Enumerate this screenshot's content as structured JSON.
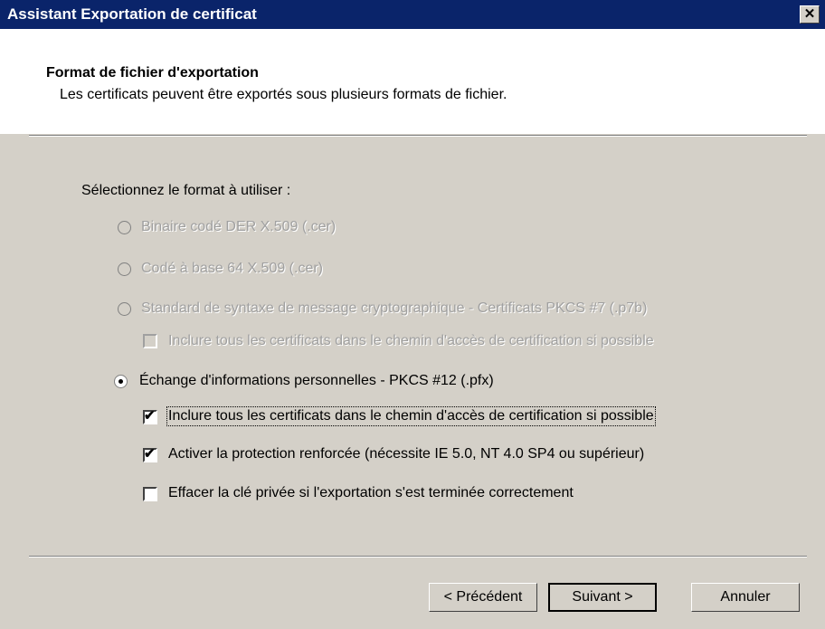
{
  "window": {
    "title": "Assistant Exportation de certificat",
    "close_glyph": "✕"
  },
  "header": {
    "title": "Format de fichier d'exportation",
    "subtitle": "Les certificats peuvent être exportés sous plusieurs formats de fichier."
  },
  "prompt": "Sélectionnez le format à utiliser :",
  "options": [
    {
      "label": "Binaire codé DER X.509 (.cer)",
      "enabled": false,
      "selected": false
    },
    {
      "label": "Codé à base 64 X.509 (.cer)",
      "enabled": false,
      "selected": false
    },
    {
      "label": "Standard de syntaxe de message cryptographique - Certificats PKCS #7 (.p7b)",
      "enabled": false,
      "selected": false
    },
    {
      "label": "Échange d'informations personnelles - PKCS #12 (.pfx)",
      "enabled": true,
      "selected": true
    }
  ],
  "checkboxes": [
    {
      "label": "Inclure tous les certificats dans le chemin d'accès de certification si possible",
      "enabled": false,
      "checked": false
    },
    {
      "label": "Inclure tous les certificats dans le chemin d'accès de certification si possible",
      "enabled": true,
      "checked": true
    },
    {
      "label": "Activer la protection renforcée (nécessite IE 5.0, NT 4.0 SP4 ou supérieur)",
      "enabled": true,
      "checked": true
    },
    {
      "label": "Effacer la clé privée si l'exportation s'est terminée correctement",
      "enabled": true,
      "checked": false
    }
  ],
  "buttons": {
    "back": "< Précédent",
    "next": "Suivant >",
    "cancel": "Annuler"
  },
  "glyphs": {
    "check": "✔"
  },
  "colors": {
    "titlebar": "#0a246a",
    "face": "#d4d0c8",
    "disabled_text": "#a0a0a0"
  }
}
